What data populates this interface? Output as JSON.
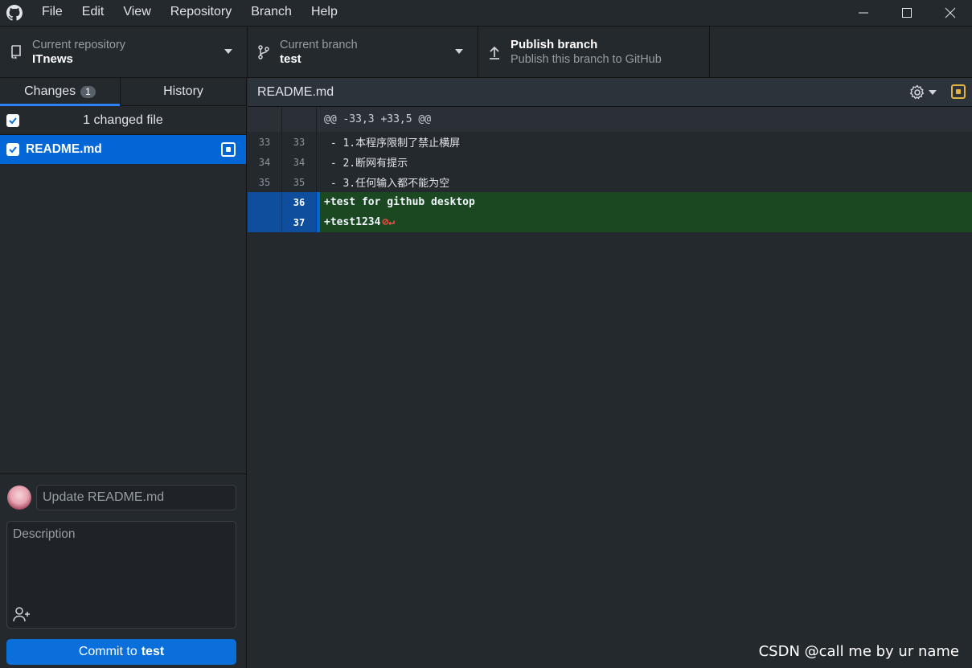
{
  "menu": [
    "File",
    "Edit",
    "View",
    "Repository",
    "Branch",
    "Help"
  ],
  "toolbar": {
    "repo_label": "Current repository",
    "repo_value": "ITnews",
    "branch_label": "Current branch",
    "branch_value": "test",
    "publish_label": "Publish branch",
    "publish_sub": "Publish this branch to GitHub"
  },
  "sidebar": {
    "tab_changes": "Changes",
    "changes_count": "1",
    "tab_history": "History",
    "changed_files_summary": "1 changed file",
    "file_name": "README.md"
  },
  "commit": {
    "summary_placeholder": "Update README.md",
    "description_placeholder": "Description",
    "button_prefix": "Commit to",
    "button_branch": "test"
  },
  "diff": {
    "file_name": "README.md",
    "hunk_header": "@@ -33,3 +33,5 @@",
    "lines": [
      {
        "type": "ctx",
        "old": "33",
        "new": "33",
        "text": " - 1.本程序限制了禁止横屏"
      },
      {
        "type": "ctx",
        "old": "34",
        "new": "34",
        "text": " - 2.断网有提示"
      },
      {
        "type": "ctx",
        "old": "35",
        "new": "35",
        "text": " - 3.任何输入都不能为空"
      },
      {
        "type": "add",
        "old": "",
        "new": "36",
        "text": "+test for github desktop"
      },
      {
        "type": "add",
        "old": "",
        "new": "37",
        "text": "+test1234",
        "no_newline": "⊘↵"
      }
    ]
  },
  "watermark": "CSDN @call me by ur name",
  "colors": {
    "accent": "#0366d6",
    "added_bg": "#1b4721",
    "modified_status": "#e3b341"
  }
}
